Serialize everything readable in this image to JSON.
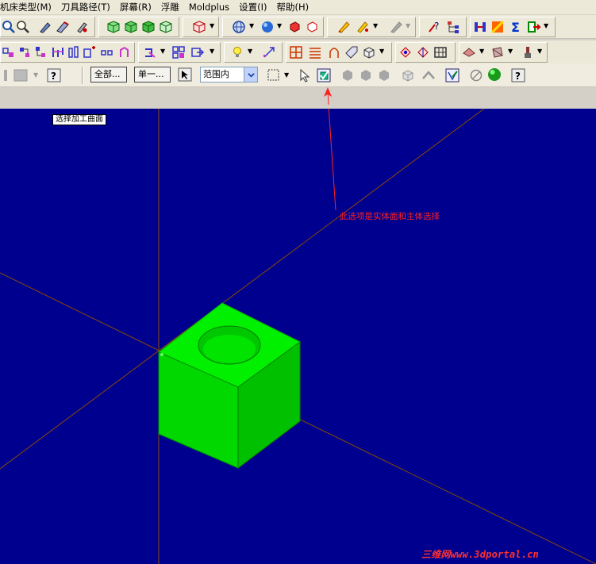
{
  "menu": {
    "items": [
      "机床类型(M)",
      "刀具路径(T)",
      "屏幕(R)",
      "浮雕",
      "Moldplus",
      "设置(I)",
      "帮助(H)"
    ]
  },
  "selection_toolbar": {
    "all_button": "全部...",
    "single_button": "单一...",
    "range_select_value": "范围内"
  },
  "viewport": {
    "tooltip": "选择加工曲面",
    "annotation": "此选项是实体面和主体选择",
    "watermark": "三维网www.3dportal.cn",
    "colors": {
      "background": "#00008f",
      "solid": "#00e000",
      "axis": "#8b4a00",
      "annotation": "#ff2020"
    }
  },
  "icons": [
    "zoom-icon",
    "tool-icons",
    "view-cube-icons",
    "sphere-icon",
    "shade-icons",
    "pencil-icon",
    "chain-select-icon",
    "curve-icons",
    "selection-arrow-icon",
    "solid-select-icon",
    "green-ball-icon",
    "help-icon"
  ]
}
